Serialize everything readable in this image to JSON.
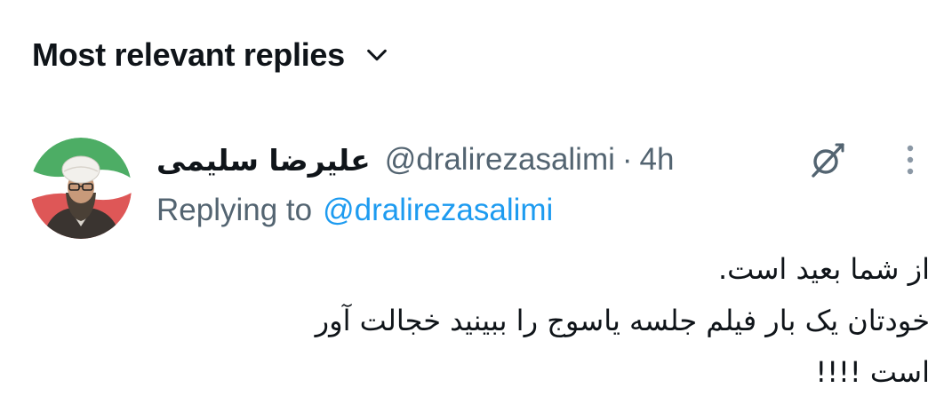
{
  "header": {
    "sort_label": "Most relevant replies",
    "sort_icon": "chevron-down-icon"
  },
  "tweet": {
    "display_name": "علیرضا سلیمی",
    "handle": "@dralirezasalimi",
    "separator": "·",
    "time": "4h",
    "reply_prefix": "Replying to",
    "reply_handle": "@dralirezasalimi",
    "body_lines": [
      "از شما بعید است.",
      "خودتان یک بار فیلم جلسه یاسوج را ببینید خجالت آور",
      "است !!!!"
    ],
    "icons": {
      "avatar": "avatar",
      "grok": "grok-icon",
      "more": "more-icon"
    }
  },
  "colors": {
    "text_primary": "#0f1419",
    "text_secondary": "#536471",
    "link": "#1d9bf0",
    "background": "#ffffff"
  }
}
